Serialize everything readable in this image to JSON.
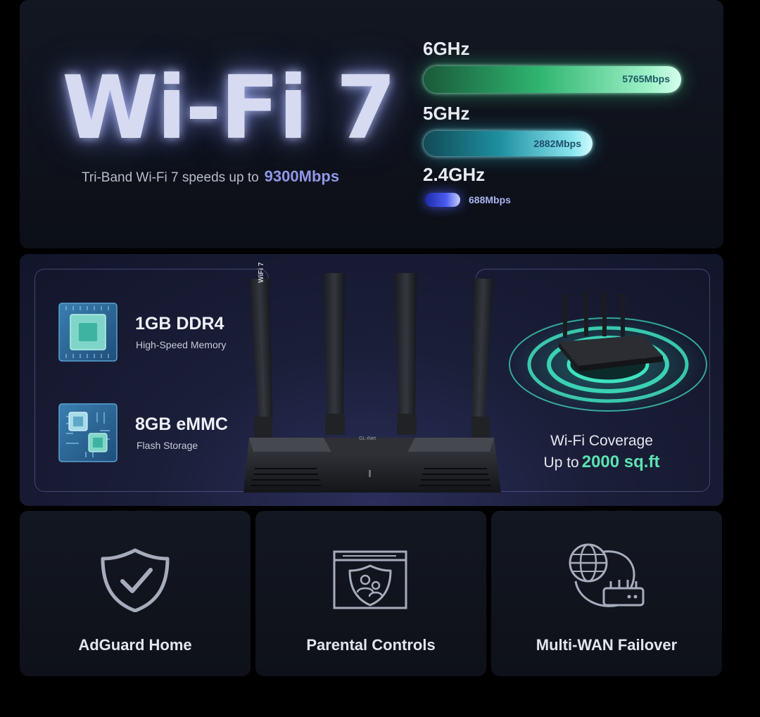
{
  "hero": {
    "title": "Wi-Fi 7",
    "tagline": "Tri-Band Wi-Fi 7 speeds up to",
    "tagline_highlight": "9300Mbps"
  },
  "bands": [
    {
      "label": "6GHz",
      "speed": "5765Mbps",
      "value_mbps": 5765,
      "color": "#2fb56f"
    },
    {
      "label": "5GHz",
      "speed": "2882Mbps",
      "value_mbps": 2882,
      "color": "#1e8fa0"
    },
    {
      "label": "2.4GHz",
      "speed": "688Mbps",
      "value_mbps": 688,
      "color": "#4a5cf0"
    }
  ],
  "specs": [
    {
      "title": "1GB DDR4",
      "subtitle": "High-Speed Memory",
      "icon": "memory-chip-icon"
    },
    {
      "title": "8GB eMMC",
      "subtitle": "Flash Storage",
      "icon": "storage-chip-icon"
    }
  ],
  "router": {
    "antenna_badge": "WiFi 7",
    "front_badge": "GL-iNet"
  },
  "coverage": {
    "line1": "Wi-Fi Coverage",
    "line2_prefix": "Up to",
    "line2_value": "2000 sq.ft"
  },
  "features": [
    {
      "label": "AdGuard Home",
      "icon": "shield-check-icon"
    },
    {
      "label": "Parental Controls",
      "icon": "parental-shield-icon"
    },
    {
      "label": "Multi-WAN Failover",
      "icon": "globe-router-icon"
    }
  ],
  "colors": {
    "accent_green": "#5ce3b1",
    "accent_blue": "#8f97e6",
    "panel_bg": "#131722"
  }
}
